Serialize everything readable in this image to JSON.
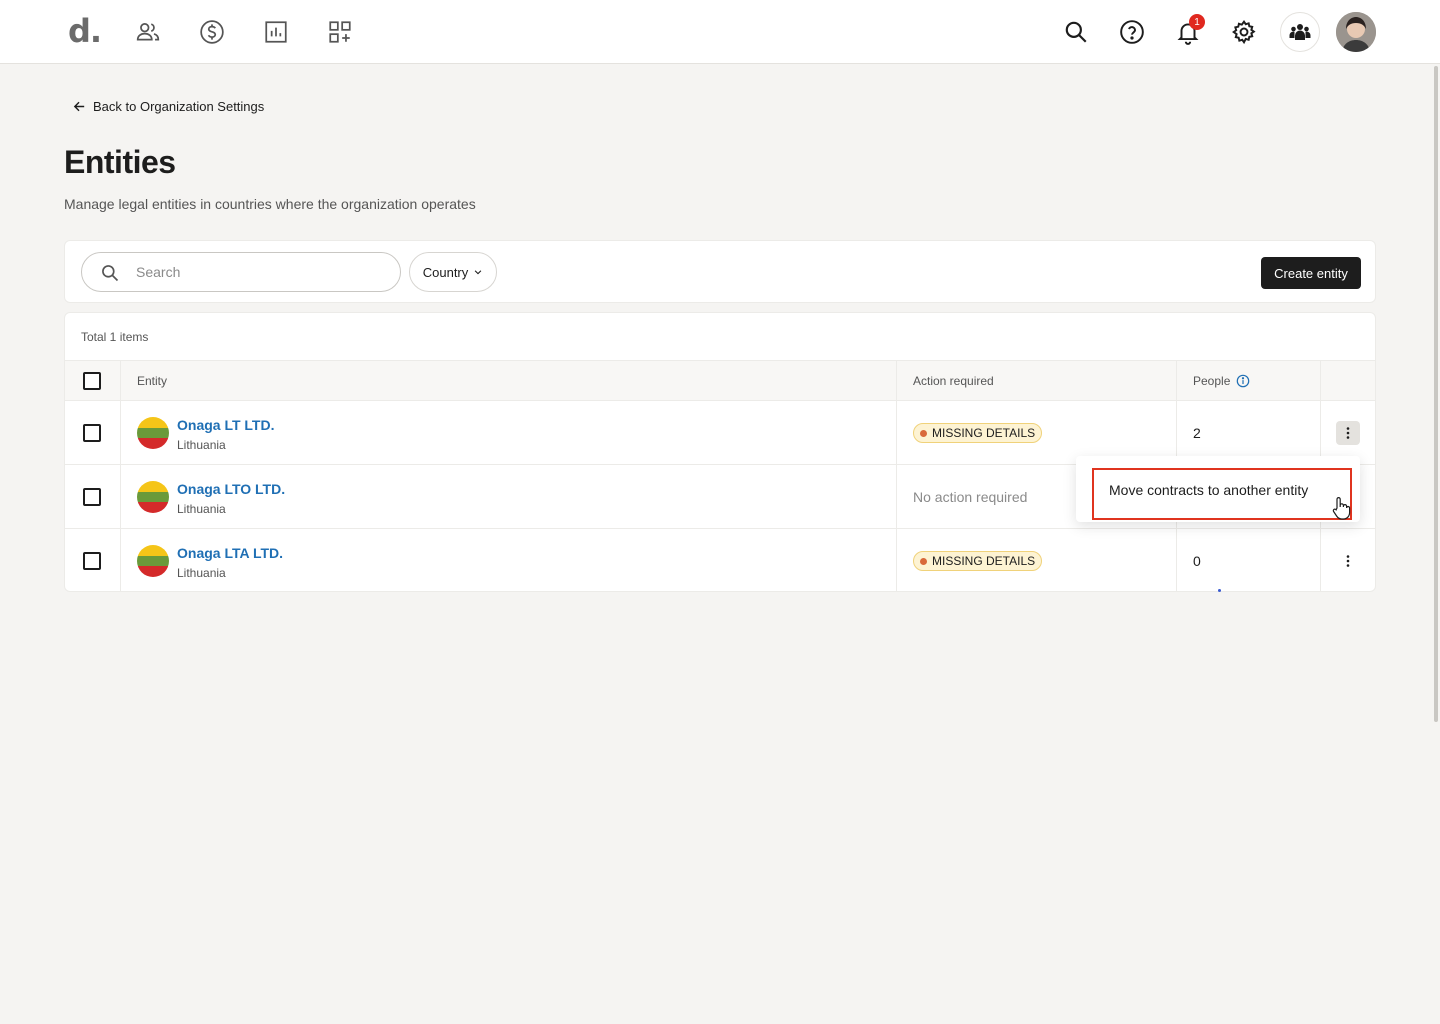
{
  "topbar": {
    "logo": "d.",
    "nav_icons": [
      "people-icon",
      "dollar-icon",
      "reports-icon",
      "apps-icon"
    ],
    "right_icons": [
      "search-icon",
      "help-icon",
      "bell-icon",
      "gear-icon",
      "org-people-icon",
      "avatar"
    ],
    "notification_count": "1"
  },
  "header": {
    "back_label": "Back to Organization Settings",
    "title": "Entities",
    "subtitle": "Manage legal entities in countries where the organization operates"
  },
  "filters": {
    "search_placeholder": "Search",
    "country_label": "Country",
    "create_label": "Create entity"
  },
  "table": {
    "total_label": "Total 1 items",
    "columns": {
      "entity": "Entity",
      "action": "Action required",
      "people": "People"
    },
    "rows": [
      {
        "name": "Onaga LT LTD.",
        "country": "Lithuania",
        "status": "MISSING DETAILS",
        "people": "2"
      },
      {
        "name": "Onaga LTO LTD.",
        "country": "Lithuania",
        "status": "No action required",
        "people": ""
      },
      {
        "name": "Onaga LTA LTD.",
        "country": "Lithuania",
        "status": "MISSING DETAILS",
        "people": "0"
      }
    ]
  },
  "menu": {
    "move_label": "Move contracts to another entity"
  },
  "colors": {
    "link": "#1f6fb4",
    "highlight": "#e0341f",
    "pill_bg": "#fdf3d3",
    "flag_yellow": "#f5c518",
    "flag_green": "#6a9a3a",
    "flag_red": "#d42a2a"
  }
}
